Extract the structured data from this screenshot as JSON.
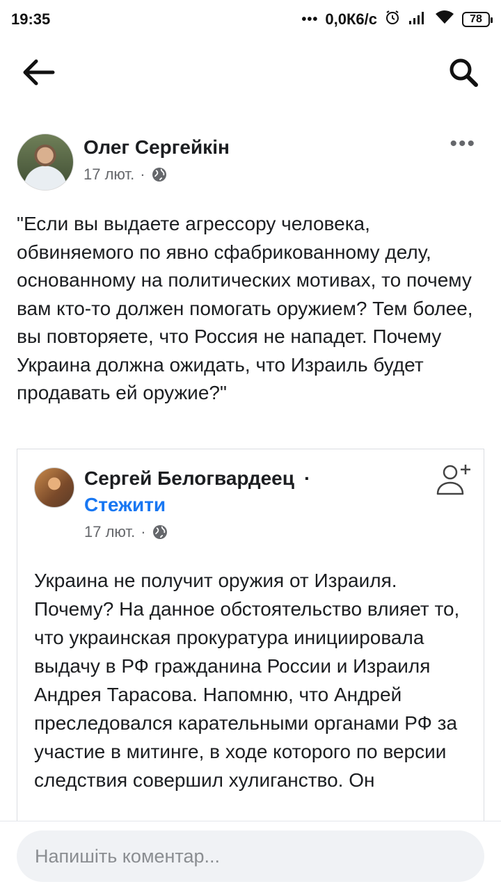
{
  "status_bar": {
    "time": "19:35",
    "dots": "•••",
    "speed": "0,0К6/с",
    "battery": "78"
  },
  "post": {
    "author": "Олег Сергейкін",
    "date": "17 лют.",
    "separator": "·",
    "more": "•••",
    "text": "\"Если вы выдаете агрессору человека, обвиняемого по явно сфабрикованному делу, основанному на политических мотивах, то почему вам кто-то должен помогать оружием? Тем более, вы повторяете, что Россия не нападет. Почему Украина должна ожидать, что Израиль будет продавать ей оружие?\""
  },
  "shared_post": {
    "author": "Сергей Белогвардеец",
    "dot": "·",
    "follow": "Стежити",
    "date": "17 лют.",
    "separator": "·",
    "text": "Украина не получит оружия от Израиля. Почему? На данное обстоятельство влияет то, что украинская прокуратура инициировала выдачу в РФ гражданина России и Израиля Андрея Тарасова. Напомню, что Андрей преследовался карательными органами РФ за участие в митинге, в ходе которого по версии следствия совершил хулиганство. Он"
  },
  "comment": {
    "placeholder": "Напишіть коментар..."
  },
  "icons": {
    "back": "arrow-left-icon",
    "search": "search-icon",
    "globe": "globe-icon",
    "add_friend": "add-friend-icon",
    "more": "more-horizontal-icon",
    "alarm": "alarm-icon",
    "signal": "signal-icon",
    "wifi": "wifi-icon",
    "battery": "battery-icon"
  },
  "colors": {
    "link": "#1877f2",
    "text": "#1c1e21",
    "secondary": "#65676b"
  }
}
